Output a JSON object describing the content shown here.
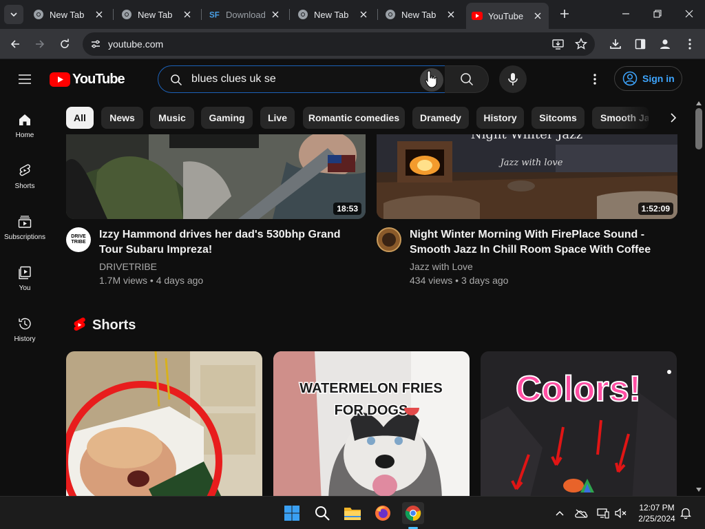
{
  "browser": {
    "tabs": [
      {
        "title": "New Tab",
        "icon": "chrome-icon"
      },
      {
        "title": "New Tab",
        "icon": "chrome-icon"
      },
      {
        "title": "Download",
        "icon": "sourceforge-icon"
      },
      {
        "title": "New Tab",
        "icon": "chrome-icon"
      },
      {
        "title": "New Tab",
        "icon": "chrome-icon"
      },
      {
        "title": "YouTube",
        "icon": "youtube-icon",
        "active": true
      }
    ],
    "url": "youtube.com"
  },
  "youtube": {
    "logo_text": "YouTube",
    "search_query": "blues clues uk se",
    "sign_in": "Sign in",
    "sidebar": [
      {
        "label": "Home",
        "icon": "home-icon"
      },
      {
        "label": "Shorts",
        "icon": "shorts-icon"
      },
      {
        "label": "Subscriptions",
        "icon": "subscriptions-icon"
      },
      {
        "label": "You",
        "icon": "you-icon"
      },
      {
        "label": "History",
        "icon": "history-icon"
      }
    ],
    "chips": [
      "All",
      "News",
      "Music",
      "Gaming",
      "Live",
      "Romantic comedies",
      "Dramedy",
      "History",
      "Sitcoms",
      "Smooth Ja"
    ],
    "videos": [
      {
        "title": "Izzy Hammond drives her dad's 530bhp Grand Tour Subaru Impreza!",
        "channel": "DRIVETRIBE",
        "views": "1.7M views",
        "age": "4 days ago",
        "duration": "18:53",
        "avatar_text": "DRIVE TRIBE"
      },
      {
        "title": "Night Winter Morning With FirePlace Sound - Smooth Jazz In Chill Room Space With Coffee",
        "channel": "Jazz with Love",
        "views": "434 views",
        "age": "3 days ago",
        "duration": "1:52:09",
        "thumb_overlay": "Night Winter Jazz",
        "thumb_script": "Jazz with love"
      }
    ],
    "shorts_heading": "Shorts",
    "shorts": [
      {
        "overlay": ""
      },
      {
        "overlay_line1": "WATERMELON FRIES",
        "overlay_line2": "FOR DOGS"
      },
      {
        "overlay": "Colors!"
      }
    ]
  },
  "taskbar": {
    "time": "12:07 PM",
    "date": "2/25/2024"
  },
  "colors": {
    "yt_red": "#ff0000",
    "link_blue": "#3ea6ff",
    "background": "#0f0f0f"
  }
}
